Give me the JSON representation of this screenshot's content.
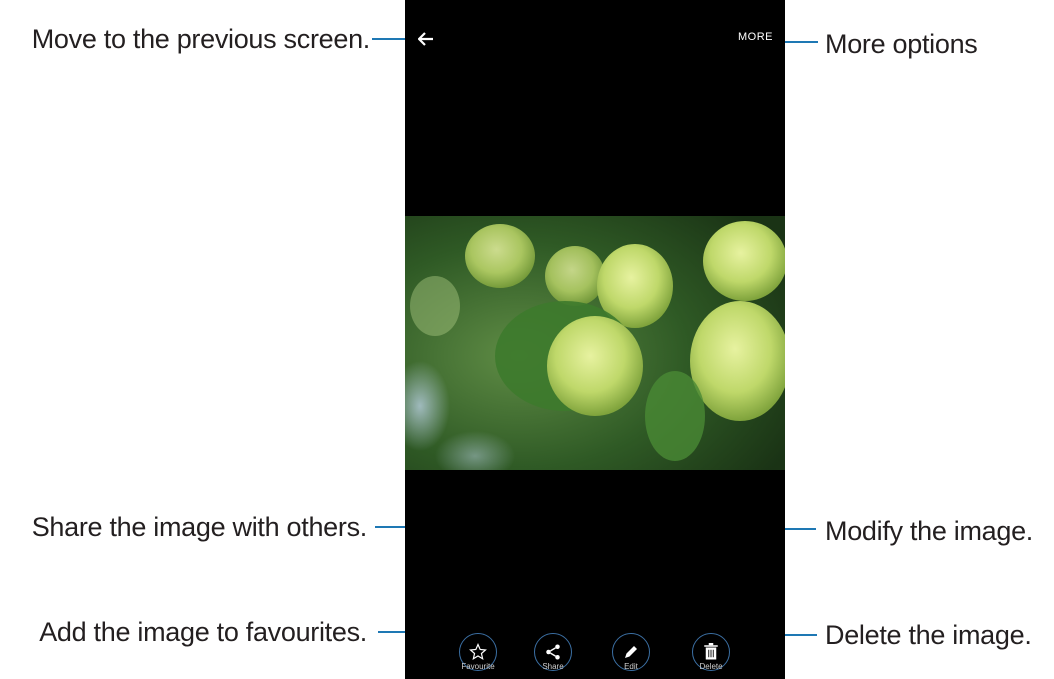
{
  "header": {
    "back_icon": "back-arrow-icon",
    "more_label": "MORE"
  },
  "callouts": {
    "back": "Move to the previous screen.",
    "more": "More options",
    "share": "Share the image with others.",
    "edit": "Modify the image.",
    "favourites": "Add the image to favourites.",
    "delete": "Delete the image."
  },
  "actions": [
    {
      "label": "Favourite",
      "icon": "star-icon"
    },
    {
      "label": "Share",
      "icon": "share-icon"
    },
    {
      "label": "Edit",
      "icon": "pencil-icon"
    },
    {
      "label": "Delete",
      "icon": "trash-icon"
    }
  ],
  "colors": {
    "callout_line": "#1e78b4",
    "screen_bg": "#000000",
    "button_ring": "#3b6fa3"
  }
}
